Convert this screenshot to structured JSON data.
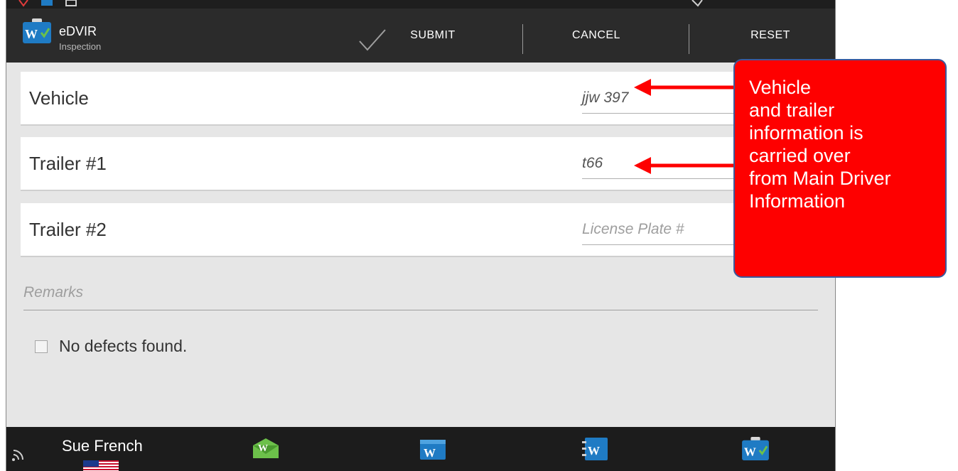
{
  "app": {
    "title": "eDVIR",
    "subtitle": "Inspection"
  },
  "actions": {
    "submit": "SUBMIT",
    "cancel": "CANCEL",
    "reset": "RESET"
  },
  "fields": [
    {
      "label": "Vehicle",
      "value": "jjw 397",
      "placeholder": ""
    },
    {
      "label": "Trailer #1",
      "value": "t66",
      "placeholder": ""
    },
    {
      "label": "Trailer #2",
      "value": "",
      "placeholder": "License Plate #"
    }
  ],
  "remarks": {
    "placeholder": "Remarks"
  },
  "no_defects": {
    "label": "No defects found.",
    "checked": false
  },
  "bottom": {
    "driver_name": "Sue French"
  },
  "annotation": {
    "text": "Vehicle\nand trailer\ninformation is\ncarried over\nfrom Main Driver\nInformation"
  },
  "colors": {
    "accent": "#1f7bc4",
    "green": "#6cc04a",
    "callout": "#fe0000",
    "bar": "#2b2b2b"
  },
  "icons": [
    "app-logo-icon",
    "check-icon",
    "wifi-icon",
    "flag-icon",
    "messages-icon",
    "hos-icon",
    "logbook-icon",
    "dvir-icon"
  ]
}
